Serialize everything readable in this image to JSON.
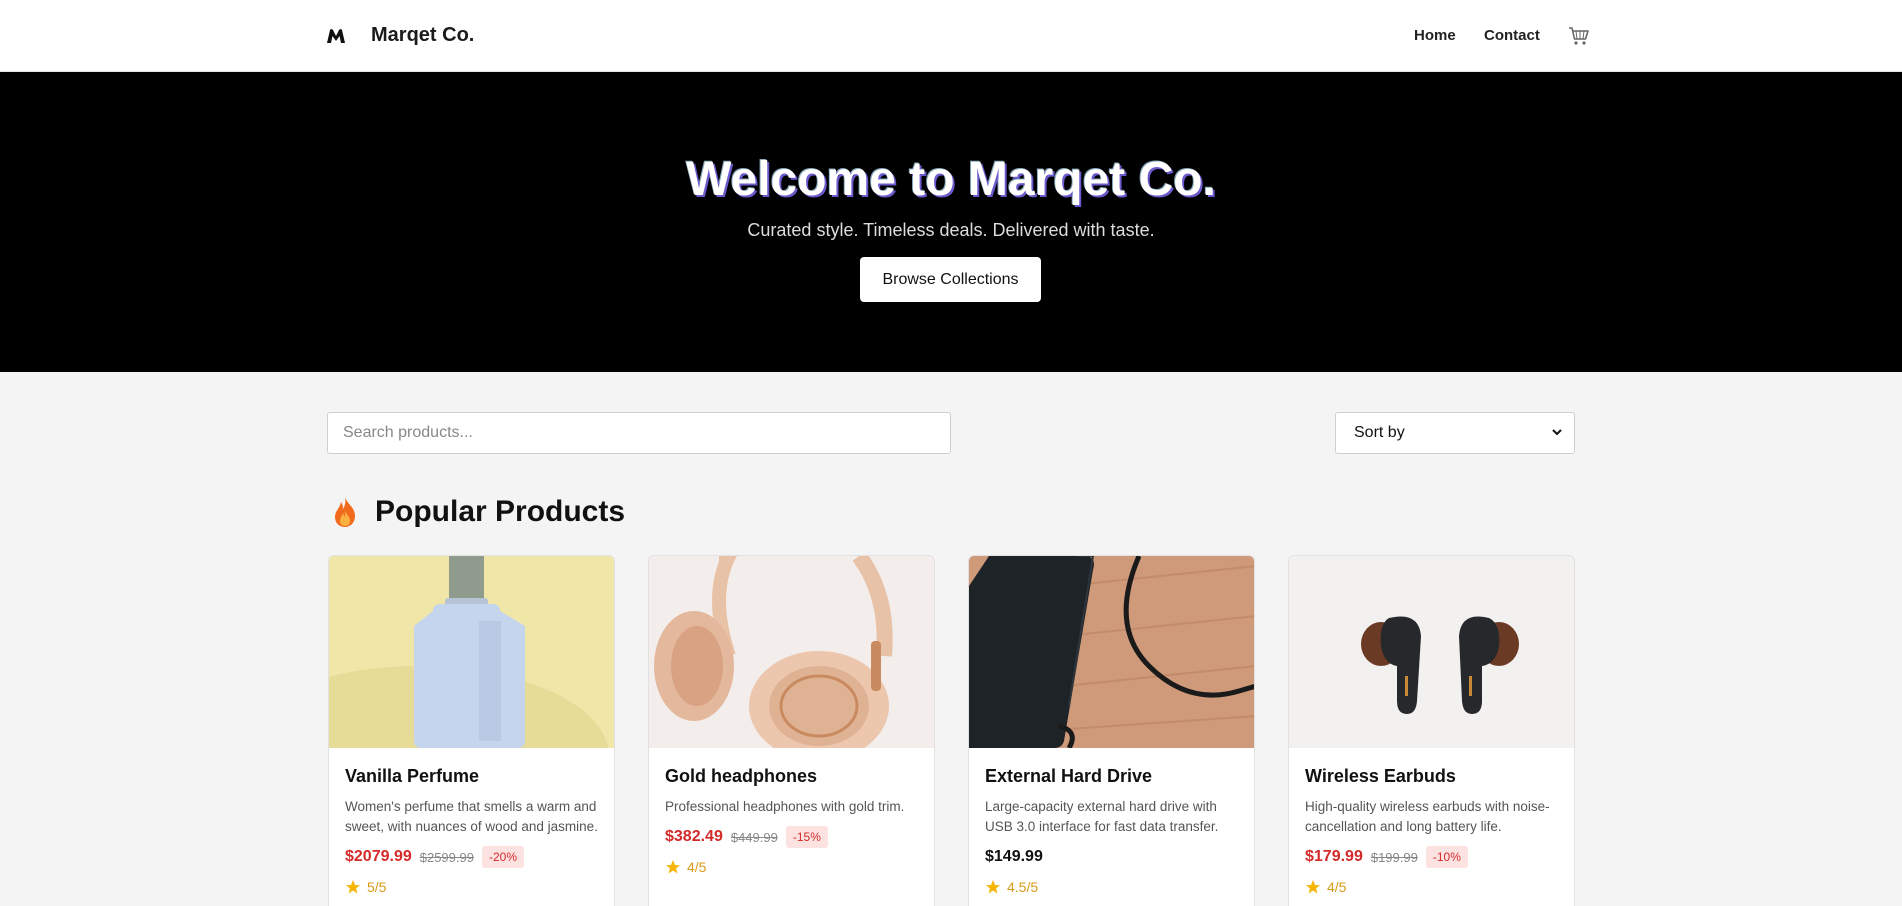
{
  "header": {
    "logo_icon": "marqet-logo-icon",
    "brand": "Marqet Co.",
    "nav": [
      {
        "label": "Home"
      },
      {
        "label": "Contact"
      }
    ],
    "cart_icon": "cart-icon"
  },
  "hero": {
    "title": "Welcome to Marqet Co.",
    "subtitle": "Curated style. Timeless deals. Delivered with taste.",
    "button_label": "Browse Collections"
  },
  "controls": {
    "search_placeholder": "Search products...",
    "sort_label": "Sort by"
  },
  "section": {
    "icon": "fire-icon",
    "title": "Popular Products"
  },
  "products": [
    {
      "name": "Vanilla Perfume",
      "description": "Women's perfume that smells a warm and sweet, with nuances of wood and jasmine.",
      "price": "$2079.99",
      "old_price": "$2599.99",
      "discount": "-20%",
      "rating": "5/5"
    },
    {
      "name": "Gold headphones",
      "description": "Professional headphones with gold trim.",
      "price": "$382.49",
      "old_price": "$449.99",
      "discount": "-15%",
      "rating": "4/5"
    },
    {
      "name": "External Hard Drive",
      "description": "Large-capacity external hard drive with USB 3.0 interface for fast data transfer.",
      "price": "$149.99",
      "rating": "4.5/5"
    },
    {
      "name": "Wireless Earbuds",
      "description": "High-quality wireless earbuds with noise-cancellation and long battery life.",
      "price": "$179.99",
      "old_price": "$199.99",
      "discount": "-10%",
      "rating": "4/5"
    }
  ],
  "colors": {
    "sale_price": "#d42a2a",
    "discount_bg": "#fde2e2",
    "rating": "#d99a17",
    "hero_bg": "#000000"
  }
}
